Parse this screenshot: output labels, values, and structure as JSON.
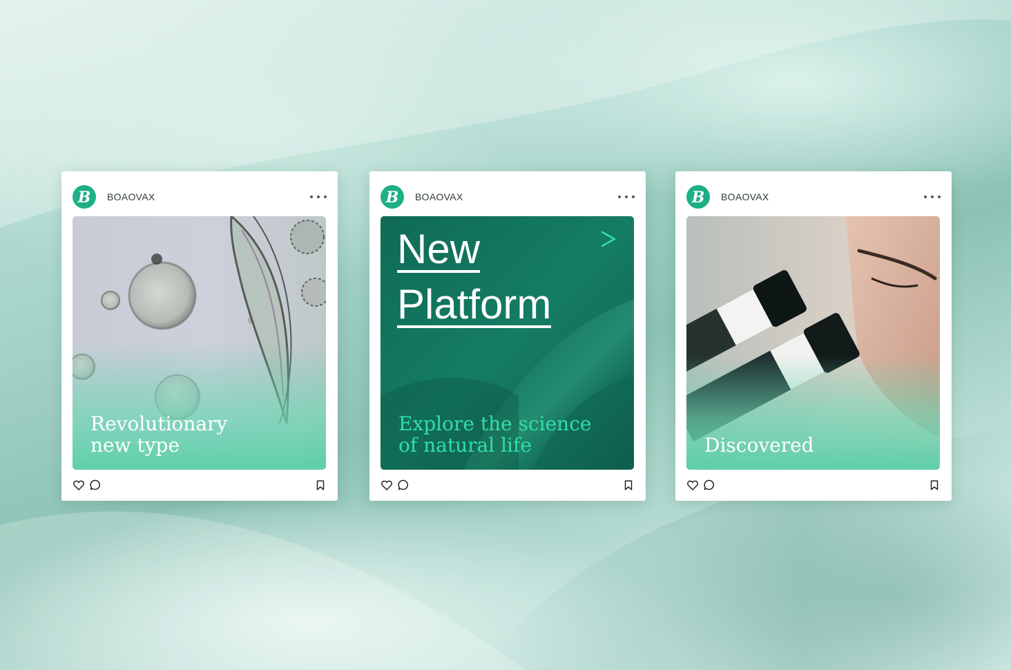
{
  "accent_color": "#1eaf86",
  "posts": [
    {
      "account": "BOAOVAX",
      "avatar_icon": "boaovax-logo-icon",
      "image": "microscope-cells-photo",
      "caption_lines": [
        "Revolutionary",
        "new type"
      ]
    },
    {
      "account": "BOAOVAX",
      "avatar_icon": "boaovax-logo-icon",
      "headline_lines": [
        "New",
        "Platform"
      ],
      "arrow": ">",
      "caption_lines": [
        "Explore the science",
        "of natural life"
      ]
    },
    {
      "account": "BOAOVAX",
      "avatar_icon": "boaovax-logo-icon",
      "image": "scientist-microscope-photo",
      "caption_lines": [
        "Discovered"
      ]
    }
  ],
  "footer_icons": [
    "heart-icon",
    "comment-icon",
    "bookmark-icon"
  ],
  "more_icon": "more-options-icon"
}
